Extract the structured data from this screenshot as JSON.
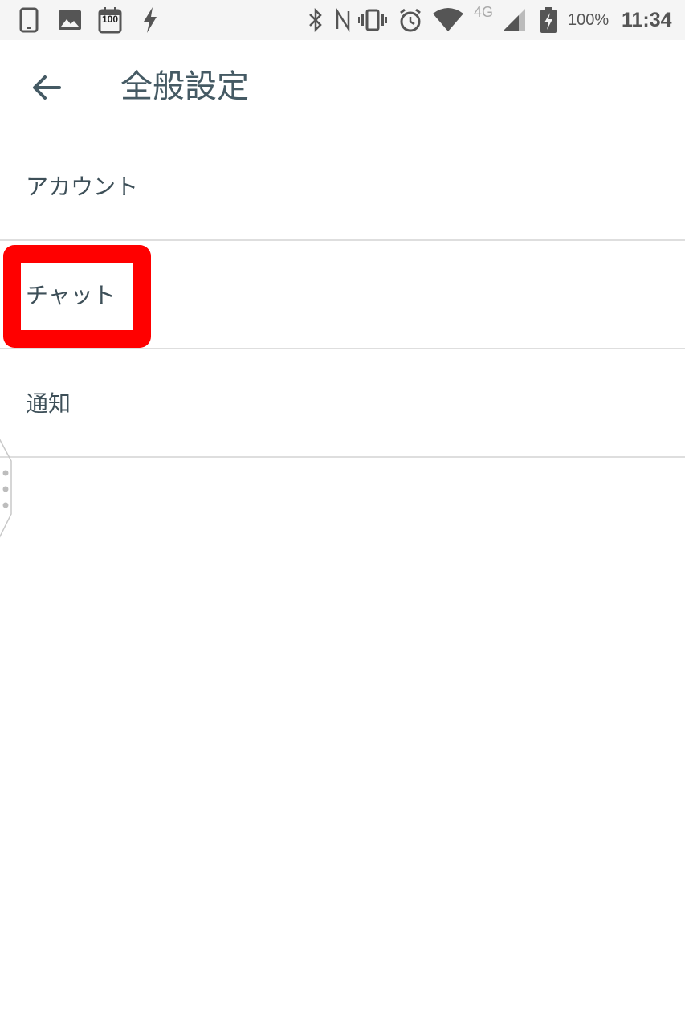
{
  "status_bar": {
    "battery_percent": "100%",
    "time": "11:34",
    "network_type": "4G",
    "notification_badge": "100",
    "icons_left": [
      "phone-icon",
      "image-icon",
      "calendar-100-icon",
      "flash-icon"
    ],
    "icons_right": [
      "bluetooth-icon",
      "nfc-icon",
      "vibrate-icon",
      "alarm-icon",
      "wifi-icon",
      "cell-signal-icon",
      "battery-charging-icon"
    ]
  },
  "app_bar": {
    "back_icon": "arrow-back-icon",
    "title": "全般設定"
  },
  "settings_list": {
    "items": [
      {
        "label": "アカウント"
      },
      {
        "label": "チャット"
      },
      {
        "label": "通知"
      }
    ]
  },
  "colors": {
    "highlight": "#ff0000",
    "text": "#37474f",
    "divider": "#dedede",
    "status_bar_bg": "#f5f5f5"
  }
}
